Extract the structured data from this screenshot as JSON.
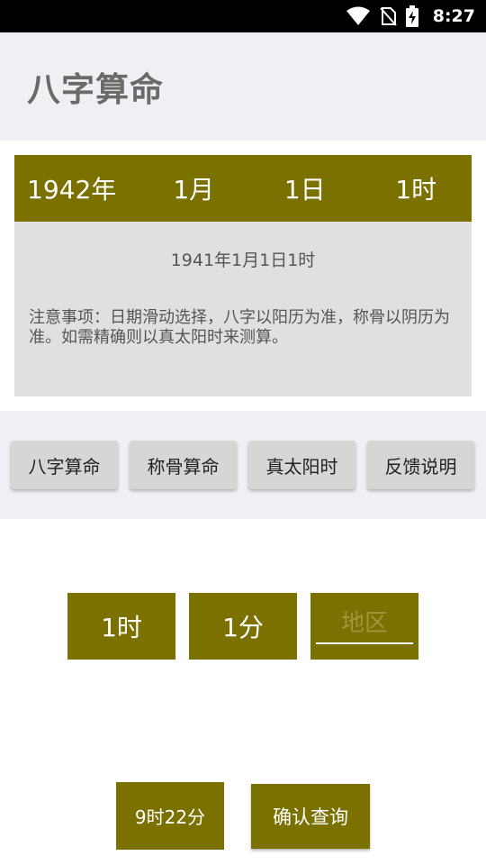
{
  "status_bar": {
    "time": "8:27",
    "icons": [
      "wifi-icon",
      "no-sim-icon",
      "battery-charging-icon"
    ]
  },
  "header": {
    "title": "八字算命"
  },
  "date_picker": {
    "year": "1942年",
    "month": "1月",
    "day": "1日",
    "hour": "1时"
  },
  "info": {
    "result": "1941年1月1日1时",
    "note": "注意事项：日期滑动选择，八字以阳历为准，称骨以阴历为准。如需精确则以真太阳时来测算。"
  },
  "tabs": [
    {
      "label": "八字算命"
    },
    {
      "label": "称骨算命"
    },
    {
      "label": "真太阳时"
    },
    {
      "label": "反馈说明"
    }
  ],
  "time_inputs": {
    "hour": "1时",
    "minute": "1分",
    "region_placeholder": "地区"
  },
  "solar_time": "9时22分",
  "confirm_label": "确认查询",
  "colors": {
    "accent": "#7a7100",
    "panel": "#e0e0e0",
    "band": "#efeff4"
  }
}
